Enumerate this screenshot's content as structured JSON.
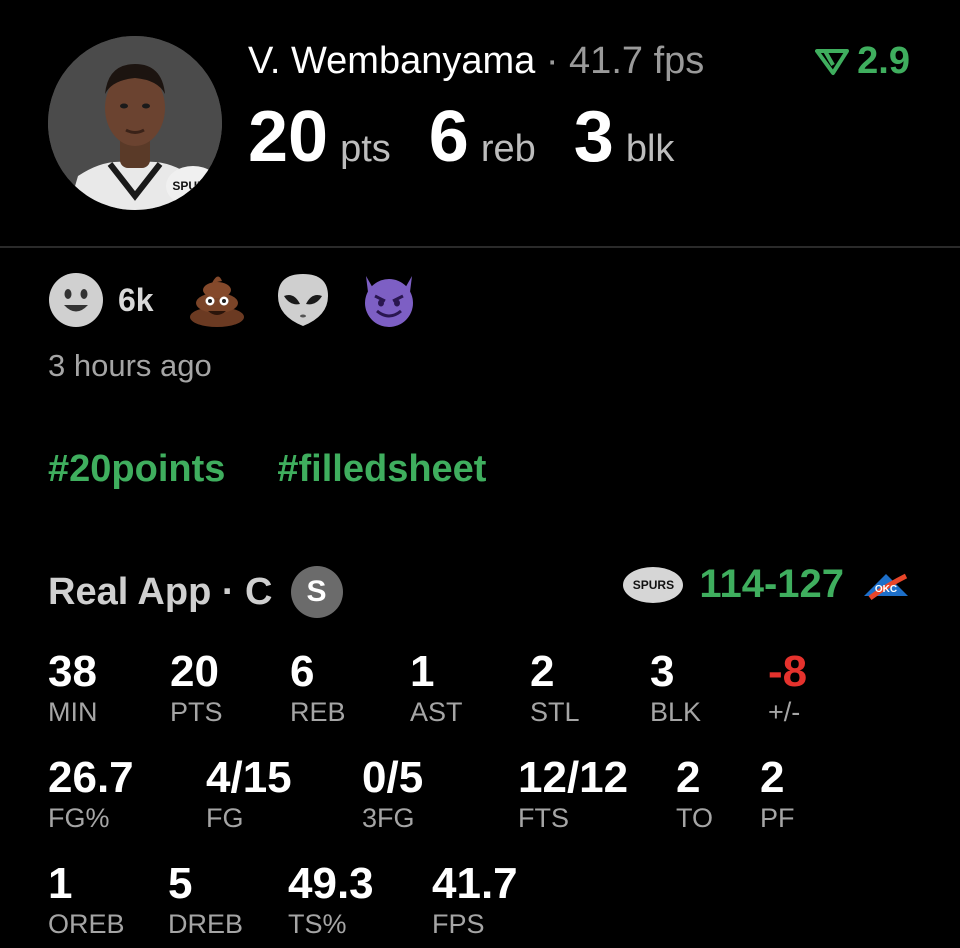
{
  "player": {
    "name": "V. Wembanyama",
    "separator": "·",
    "fps_text": "41.7 fps",
    "delta": "2.9",
    "headline": [
      {
        "value": "20",
        "unit": "pts"
      },
      {
        "value": "6",
        "unit": "reb"
      },
      {
        "value": "3",
        "unit": "blk"
      }
    ]
  },
  "reactions": {
    "count": "6k",
    "icons": [
      "smile-icon",
      "poop-icon",
      "alien-icon",
      "devil-icon"
    ]
  },
  "time_ago": "3 hours ago",
  "tags": [
    "#20points",
    "#filledsheet"
  ],
  "game": {
    "source": "Real App · C",
    "badge": "S",
    "score": "114-127",
    "team_logo_text": "SPURS",
    "opp_logo_text": "OKC"
  },
  "stats": {
    "row1": [
      {
        "value": "38",
        "label": "MIN"
      },
      {
        "value": "20",
        "label": "PTS"
      },
      {
        "value": "6",
        "label": "REB"
      },
      {
        "value": "1",
        "label": "AST"
      },
      {
        "value": "2",
        "label": "STL"
      },
      {
        "value": "3",
        "label": "BLK"
      },
      {
        "value": "-8",
        "label": "+/-"
      }
    ],
    "row2": [
      {
        "value": "26.7",
        "label": "FG%"
      },
      {
        "value": "4/15",
        "label": "FG"
      },
      {
        "value": "0/5",
        "label": "3FG"
      },
      {
        "value": "12/12",
        "label": "FTS"
      },
      {
        "value": "2",
        "label": "TO"
      },
      {
        "value": "2",
        "label": "PF"
      }
    ],
    "row3": [
      {
        "value": "1",
        "label": "OREB"
      },
      {
        "value": "5",
        "label": "DREB"
      },
      {
        "value": "49.3",
        "label": "TS%"
      },
      {
        "value": "41.7",
        "label": "FPS"
      }
    ]
  },
  "colors": {
    "accent_green": "#3fae5e",
    "negative_red": "#e5322d",
    "background": "#000000"
  }
}
